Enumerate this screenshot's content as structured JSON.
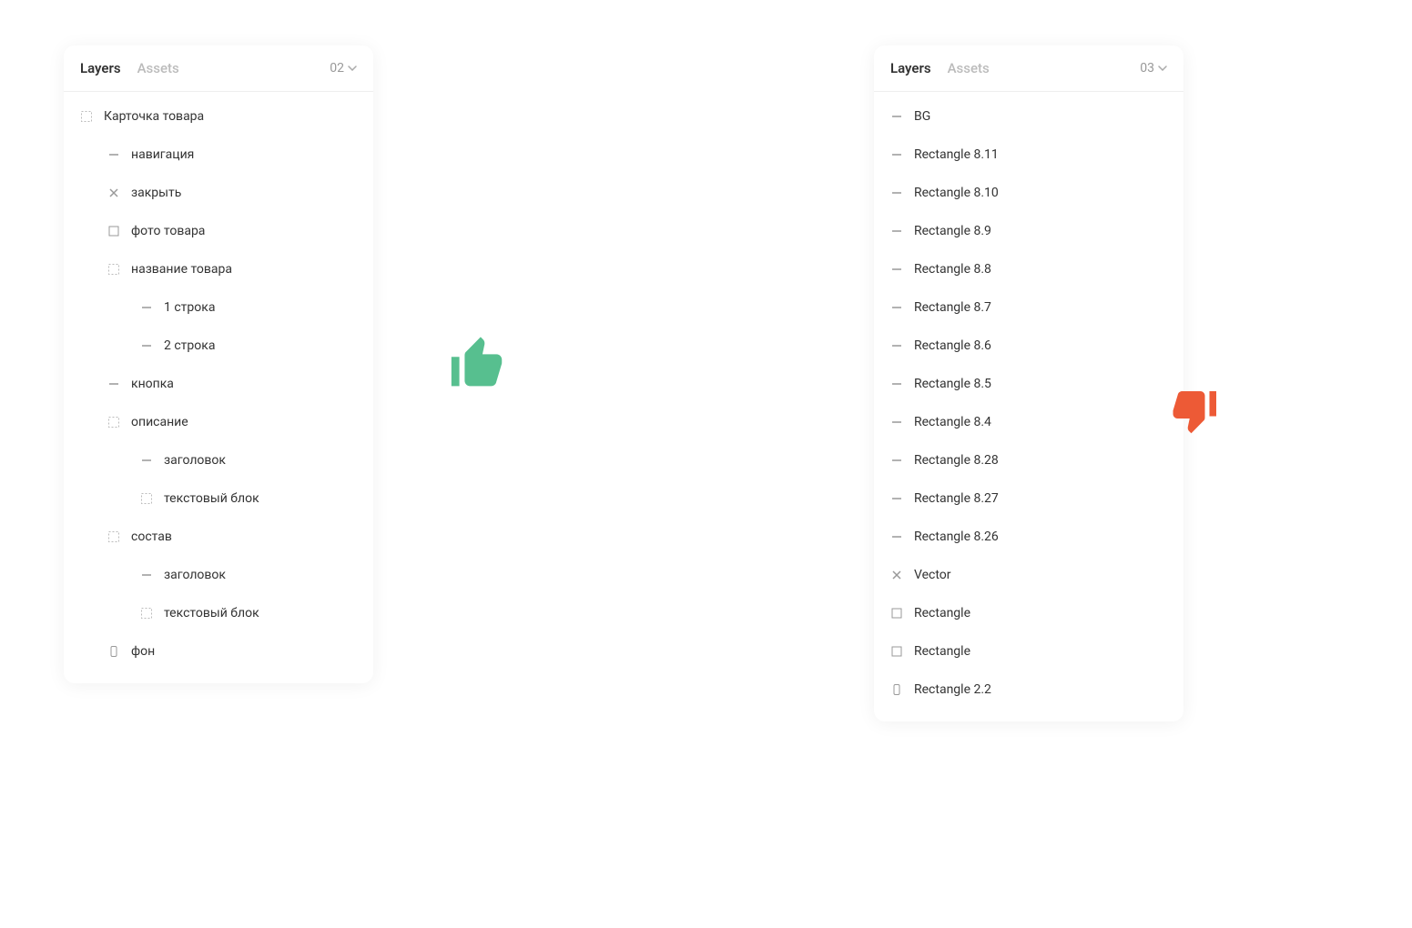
{
  "tabs": {
    "layers": "Layers",
    "assets": "Assets"
  },
  "colors": {
    "good": "#57bf8f",
    "bad": "#ed5a36"
  },
  "good_panel": {
    "page": "02",
    "layers": [
      {
        "icon": "frame-dashed",
        "label": "Карточка товара",
        "indent": 0
      },
      {
        "icon": "line",
        "label": "навигация",
        "indent": 1
      },
      {
        "icon": "close",
        "label": "закрыть",
        "indent": 1
      },
      {
        "icon": "rect",
        "label": "фото товара",
        "indent": 1
      },
      {
        "icon": "frame-dashed",
        "label": "название товара",
        "indent": 1
      },
      {
        "icon": "line",
        "label": "1 строка",
        "indent": 2
      },
      {
        "icon": "line",
        "label": "2 строка",
        "indent": 2
      },
      {
        "icon": "line",
        "label": "кнопка",
        "indent": 1
      },
      {
        "icon": "frame-dashed",
        "label": "описание",
        "indent": 1
      },
      {
        "icon": "line",
        "label": "заголовок",
        "indent": 2
      },
      {
        "icon": "frame-dashed",
        "label": "текстовый блок",
        "indent": 2
      },
      {
        "icon": "frame-dashed",
        "label": "состав",
        "indent": 1
      },
      {
        "icon": "line",
        "label": "заголовок",
        "indent": 2
      },
      {
        "icon": "frame-dashed",
        "label": "текстовый блок",
        "indent": 2
      },
      {
        "icon": "phone",
        "label": "фон",
        "indent": 1
      }
    ]
  },
  "bad_panel": {
    "page": "03",
    "layers": [
      {
        "icon": "line",
        "label": "BG",
        "indent": 0
      },
      {
        "icon": "line",
        "label": "Rectangle 8.11",
        "indent": 0
      },
      {
        "icon": "line",
        "label": "Rectangle 8.10",
        "indent": 0
      },
      {
        "icon": "line",
        "label": "Rectangle 8.9",
        "indent": 0
      },
      {
        "icon": "line",
        "label": "Rectangle 8.8",
        "indent": 0
      },
      {
        "icon": "line",
        "label": "Rectangle 8.7",
        "indent": 0
      },
      {
        "icon": "line",
        "label": "Rectangle 8.6",
        "indent": 0
      },
      {
        "icon": "line",
        "label": "Rectangle 8.5",
        "indent": 0
      },
      {
        "icon": "line",
        "label": "Rectangle 8.4",
        "indent": 0
      },
      {
        "icon": "line",
        "label": "Rectangle 8.28",
        "indent": 0
      },
      {
        "icon": "line",
        "label": "Rectangle 8.27",
        "indent": 0
      },
      {
        "icon": "line",
        "label": "Rectangle 8.26",
        "indent": 0
      },
      {
        "icon": "close",
        "label": "Vector",
        "indent": 0
      },
      {
        "icon": "rect",
        "label": "Rectangle",
        "indent": 0
      },
      {
        "icon": "rect",
        "label": "Rectangle",
        "indent": 0
      },
      {
        "icon": "phone",
        "label": "Rectangle 2.2",
        "indent": 0
      }
    ]
  }
}
